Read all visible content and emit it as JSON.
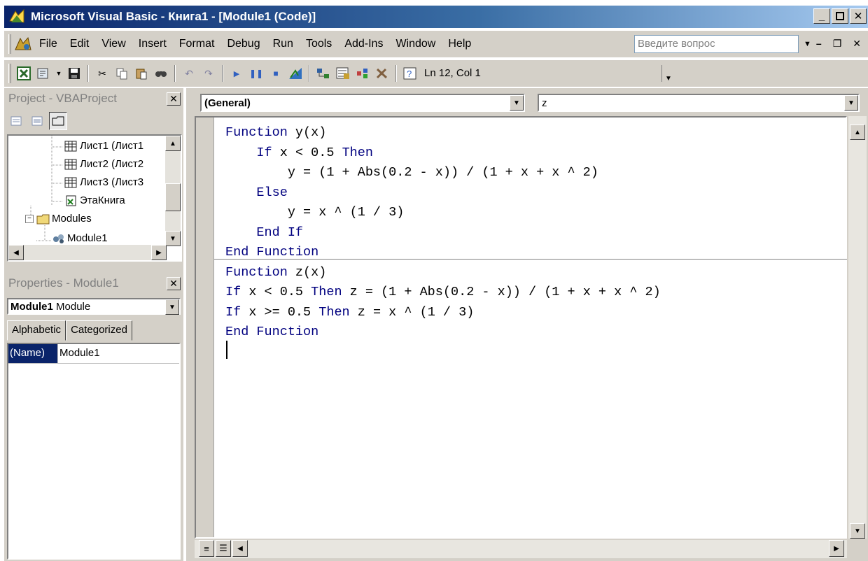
{
  "window": {
    "title": "Microsoft Visual Basic - Книга1 - [Module1 (Code)]"
  },
  "menu": [
    "File",
    "Edit",
    "View",
    "Insert",
    "Format",
    "Debug",
    "Run",
    "Tools",
    "Add-Ins",
    "Window",
    "Help"
  ],
  "help_box": {
    "placeholder": "Введите вопрос"
  },
  "toolbar": {
    "position": "Ln 12, Col 1"
  },
  "project": {
    "title": "Project - VBAProject",
    "tree": [
      {
        "label": "Лист1 (Лист1",
        "icon": "sheet-icon"
      },
      {
        "label": "Лист2 (Лист2",
        "icon": "sheet-icon"
      },
      {
        "label": "Лист3 (Лист3",
        "icon": "sheet-icon"
      },
      {
        "label": "ЭтаКнига",
        "icon": "workbook-icon"
      },
      {
        "label": "Modules",
        "icon": "folder-icon"
      },
      {
        "label": "Module1",
        "icon": "module-icon"
      }
    ]
  },
  "properties": {
    "title": "Properties - Module1",
    "object_name": "Module1",
    "object_type": "Module",
    "tabs": [
      "Alphabetic",
      "Categorized"
    ],
    "rows": [
      {
        "name": "(Name)",
        "value": "Module1"
      }
    ]
  },
  "code": {
    "object_combo": "(General)",
    "proc_combo": "z",
    "lines": [
      "Function y(x)",
      "    If x < 0.5 Then",
      "        y = (1 + Abs(0.2 - x)) / (1 + x + x ^ 2)",
      "    Else",
      "        y = x ^ (1 / 3)",
      "    End If",
      "End Function",
      "Function z(x)",
      "If x < 0.5 Then z = (1 + Abs(0.2 - x)) / (1 + x + x ^ 2)",
      "If x >= 0.5 Then z = x ^ (1 / 3)",
      "End Function",
      ""
    ]
  },
  "colors": {
    "titlebar_start": "#0a246a",
    "titlebar_end": "#a6caf0",
    "chrome": "#d4d0c8",
    "keyword": "#00007f"
  }
}
